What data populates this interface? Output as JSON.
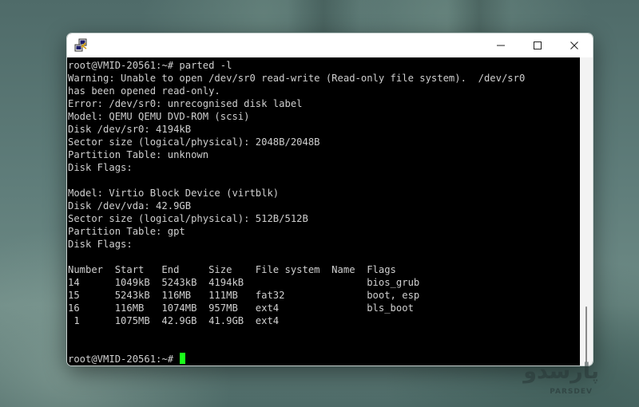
{
  "window": {
    "app_icon": "putty-icon",
    "controls": {
      "minimize_icon": "minimize-icon",
      "maximize_icon": "maximize-icon",
      "close_icon": "close-icon"
    }
  },
  "terminal": {
    "lines": [
      "root@VMID-20561:~# parted -l",
      "Warning: Unable to open /dev/sr0 read-write (Read-only file system).  /dev/sr0",
      "has been opened read-only.",
      "Error: /dev/sr0: unrecognised disk label",
      "Model: QEMU QEMU DVD-ROM (scsi)",
      "Disk /dev/sr0: 4194kB",
      "Sector size (logical/physical): 2048B/2048B",
      "Partition Table: unknown",
      "Disk Flags:",
      "",
      "Model: Virtio Block Device (virtblk)",
      "Disk /dev/vda: 42.9GB",
      "Sector size (logical/physical): 512B/512B",
      "Partition Table: gpt",
      "Disk Flags:",
      "",
      "Number  Start   End     Size    File system  Name  Flags",
      "14      1049kB  5243kB  4194kB                     bios_grub",
      "15      5243kB  116MB   111MB   fat32              boot, esp",
      "16      116MB   1074MB  957MB   ext4               bls_boot",
      " 1      1075MB  42.9GB  41.9GB  ext4",
      "",
      ""
    ],
    "prompt": "root@VMID-20561:~#",
    "cursor_color": "#1aff1a",
    "text_color": "#cfcfcf",
    "background_color": "#000000"
  },
  "watermark": {
    "script_text": "پارسدو",
    "latin_text": "PARSDEV"
  }
}
